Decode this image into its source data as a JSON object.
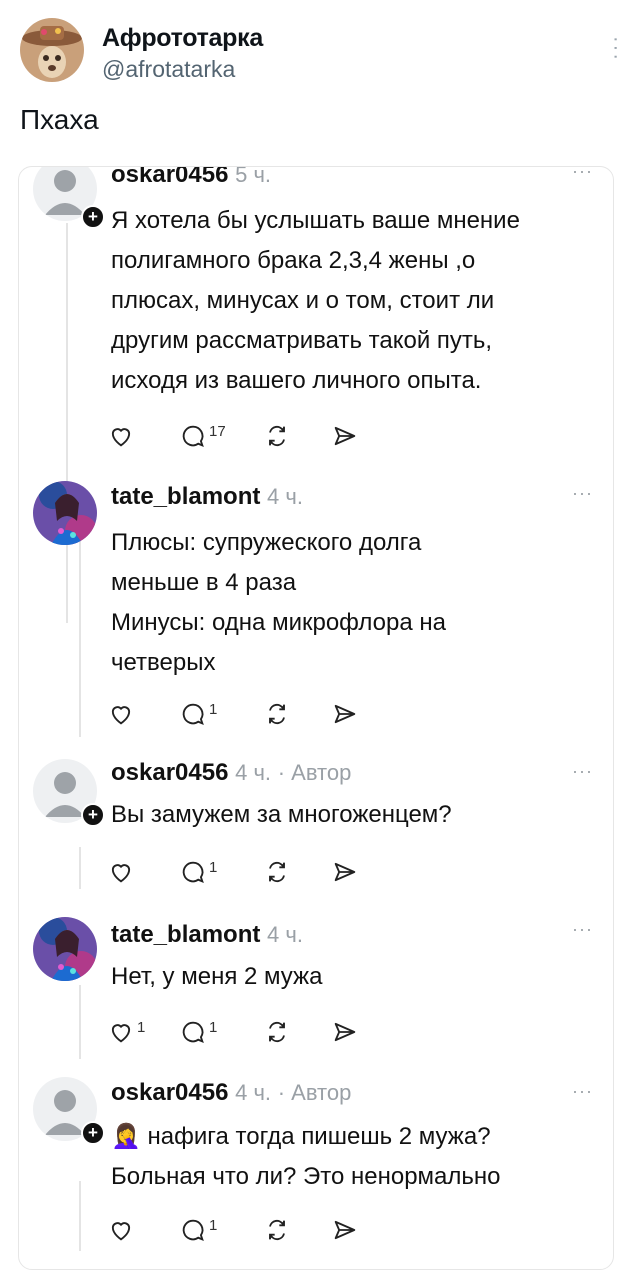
{
  "tweet": {
    "author_name": "Афрототарка",
    "author_handle": "@afrotatarka",
    "text": "Пхаха"
  },
  "comments": [
    {
      "username": "oskar0456",
      "time": "5 ч.",
      "author_tag": "",
      "lines": [
        "Я хотела бы услышать ваше мнение",
        "полигамного брака 2,3,4 жены ,о",
        "плюсах, минусах и о том, стоит ли",
        "другим рассматривать такой путь,",
        "исходя из вашего личного опыта."
      ],
      "likes": "",
      "replies": "17"
    },
    {
      "username": "tate_blamont",
      "time": "4 ч.",
      "author_tag": "",
      "lines": [
        "Плюсы: супружеского долга",
        "меньше в 4 раза",
        "Минусы: одна микрофлора на",
        "четверых"
      ],
      "likes": "",
      "replies": "1"
    },
    {
      "username": "oskar0456",
      "time": "4 ч.",
      "author_tag": "· Автор",
      "lines": [
        "Вы замужем за многоженцем?"
      ],
      "likes": "",
      "replies": "1"
    },
    {
      "username": "tate_blamont",
      "time": "4 ч.",
      "author_tag": "",
      "lines": [
        "Нет, у меня 2 мужа"
      ],
      "likes": "1",
      "replies": "1"
    },
    {
      "username": "oskar0456",
      "time": "4 ч.",
      "author_tag": "· Автор",
      "lines": [
        "🤦‍♀️ нафига тогда пишешь 2 мужа?",
        "Больная что ли? Это ненормально"
      ],
      "likes": "",
      "replies": "1"
    }
  ],
  "colors": {
    "primary_text": "#111111",
    "muted_text": "#9aa0a6",
    "handle": "#536471"
  }
}
